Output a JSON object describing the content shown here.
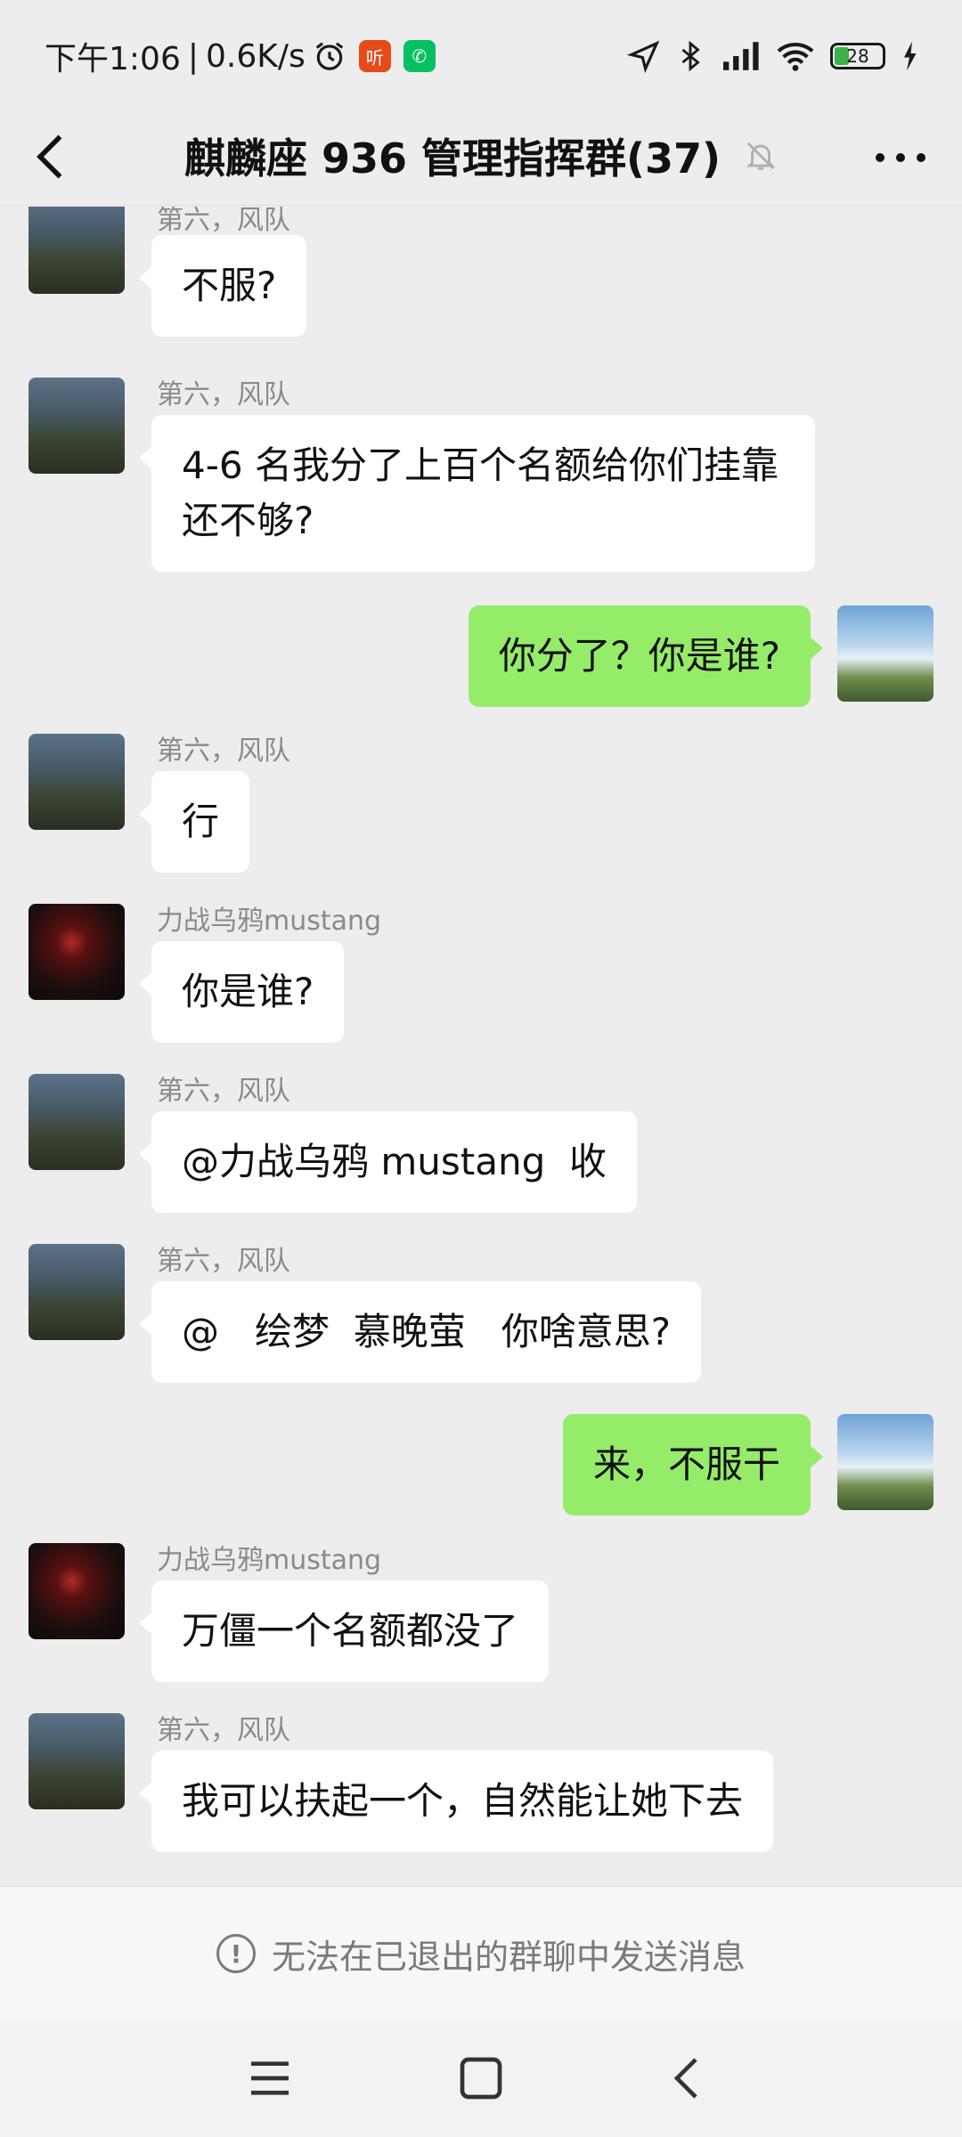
{
  "status_bar": {
    "time": "下午1:06",
    "net_speed": "0.6K/s",
    "badge_listen": "听",
    "badge_chat": "✆",
    "battery": "28"
  },
  "header": {
    "title": "麒麟座 936 管理指挥群(37)"
  },
  "messages": [
    {
      "side": "in",
      "sender": "第六，风队",
      "text": "不服?",
      "avatar": "soldier"
    },
    {
      "side": "in",
      "sender": "第六，风队",
      "text": "4-6 名我分了上百个名额给你们挂靠还不够?",
      "avatar": "soldier"
    },
    {
      "side": "out",
      "sender": "",
      "text": "你分了？你是谁?",
      "avatar": "sky"
    },
    {
      "side": "in",
      "sender": "第六，风队",
      "text": "行",
      "avatar": "soldier"
    },
    {
      "side": "in",
      "sender": "力战乌鸦mustang",
      "text": "你是谁?",
      "avatar": "dark"
    },
    {
      "side": "in",
      "sender": "第六，风队",
      "text": "@力战乌鸦 mustang  收",
      "avatar": "soldier"
    },
    {
      "side": "in",
      "sender": "第六，风队",
      "text": "@   绘梦  慕晚萤   你啥意思?",
      "avatar": "soldier"
    },
    {
      "side": "out",
      "sender": "",
      "text": "来，不服干",
      "avatar": "sky"
    },
    {
      "side": "in",
      "sender": "力战乌鸦mustang",
      "text": "万僵一个名额都没了",
      "avatar": "dark"
    },
    {
      "side": "in",
      "sender": "第六，风队",
      "text": "我可以扶起一个，自然能让她下去",
      "avatar": "soldier"
    }
  ],
  "notice": {
    "icon": "!",
    "text": "无法在已退出的群聊中发送消息"
  }
}
